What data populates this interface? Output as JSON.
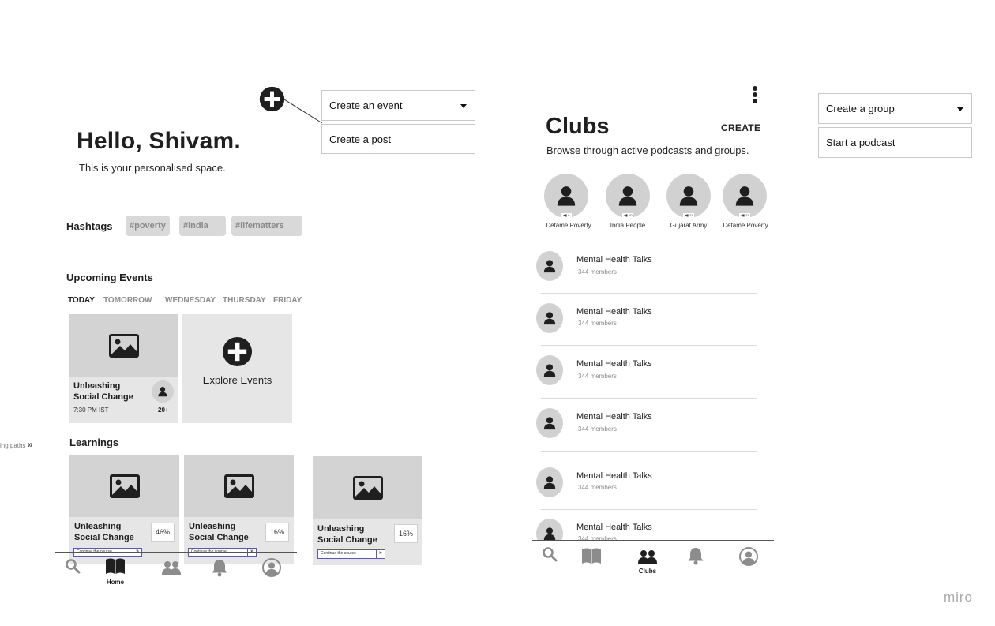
{
  "home": {
    "greeting": "Hello, Shivam.",
    "subtitle": "This is your personalised space.",
    "hashtags_label": "Hashtags",
    "hashtags": [
      "#poverty",
      "#india",
      "#lifematters"
    ],
    "upcoming_label": "Upcoming Events",
    "days": [
      "TODAY",
      "TOMORROW",
      "WEDNESDAY",
      "THURSDAY",
      "FRIDAY"
    ],
    "event_card": {
      "title": "Unleashing Social Change",
      "time": "7:30 PM IST",
      "attendees": "20+"
    },
    "explore_label": "Explore Events",
    "learnings_label": "Learnings",
    "learning_paths_link": "ing paths",
    "learnings": [
      {
        "title": "Unleashing Social Change",
        "progress": "46%",
        "cta": "Continue the course"
      },
      {
        "title": "Unleashing Social Change",
        "progress": "16%",
        "cta": "Continue the course"
      },
      {
        "title": "Unleashing Social Change",
        "progress": "16%",
        "cta": "Continue the course"
      }
    ],
    "nav": {
      "home_label": "Home"
    }
  },
  "add_menu": {
    "option_event": "Create an event",
    "option_post": "Create a post"
  },
  "clubs": {
    "title": "Clubs",
    "create_label": "CREATE",
    "subtitle": "Browse through active podcasts and groups.",
    "stories": [
      {
        "name": "Defame Poverty",
        "badge": "◀▮ 9"
      },
      {
        "name": "India People",
        "badge": "◀▮ 10"
      },
      {
        "name": "Gujarat Army",
        "badge": "◀▮ 11"
      },
      {
        "name": "Defame Poverty",
        "badge": "◀▮ 11"
      }
    ],
    "groups": [
      {
        "name": "Mental Health Talks",
        "members": "344 members"
      },
      {
        "name": "Mental Health Talks",
        "members": "344 members"
      },
      {
        "name": "Mental Health Talks",
        "members": "344 members"
      },
      {
        "name": "Mental Health Talks",
        "members": "344 members"
      },
      {
        "name": "Mental Health Talks",
        "members": "344 members"
      },
      {
        "name": "Mental Health Talks",
        "members": "344 members"
      }
    ],
    "nav": {
      "clubs_label": "Clubs"
    }
  },
  "clubs_menu": {
    "option_group": "Create a group",
    "option_podcast": "Start a podcast"
  },
  "watermark": "miro"
}
